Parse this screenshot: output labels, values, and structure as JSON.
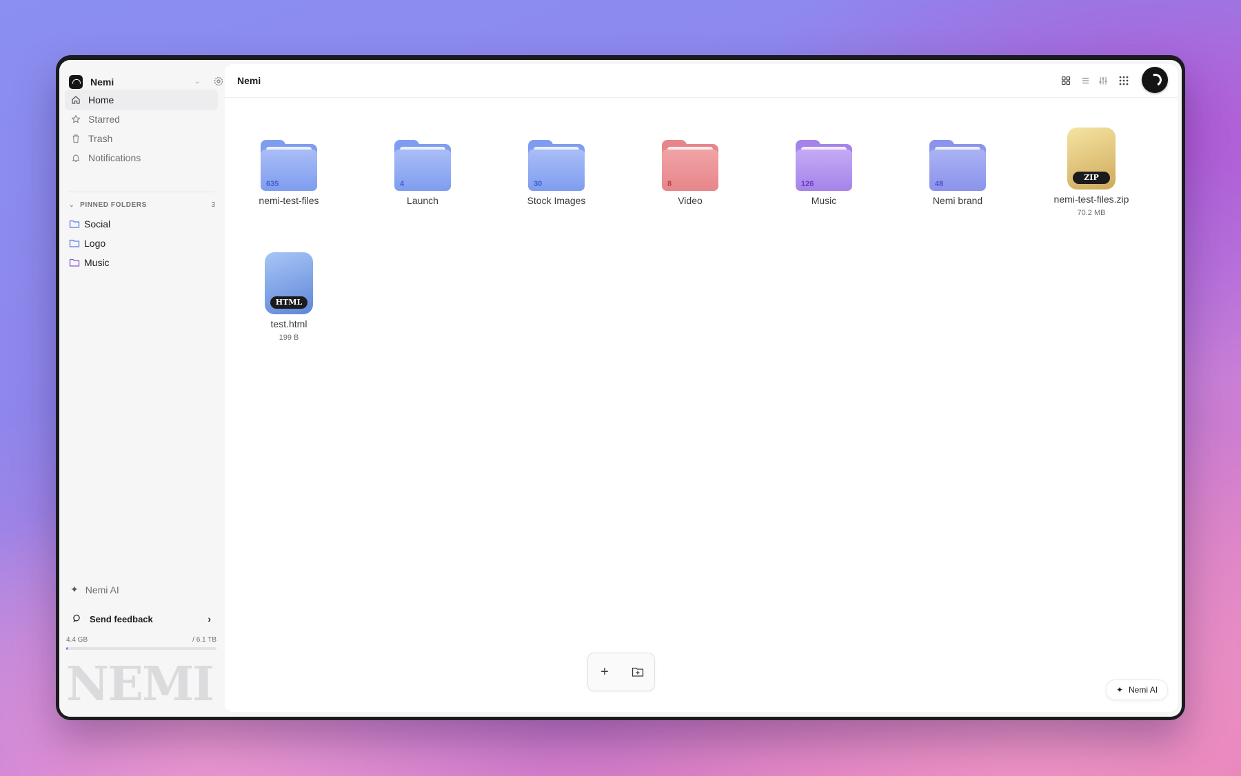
{
  "workspace": {
    "name": "Nemi"
  },
  "sidebar": {
    "nav": [
      {
        "label": "Home",
        "icon": "home-icon",
        "active": true
      },
      {
        "label": "Starred",
        "icon": "star-icon",
        "active": false
      },
      {
        "label": "Trash",
        "icon": "trash-icon",
        "active": false
      },
      {
        "label": "Notifications",
        "icon": "bell-icon",
        "active": false
      }
    ],
    "pinned": {
      "heading": "PINNED FOLDERS",
      "count": "3",
      "items": [
        {
          "label": "Social",
          "color": "#5b78e6"
        },
        {
          "label": "Logo",
          "color": "#5b78e6"
        },
        {
          "label": "Music",
          "color": "#8a56d9"
        }
      ]
    },
    "ai_label": "Nemi AI",
    "feedback_label": "Send feedback",
    "storage": {
      "used": "4.4 GB",
      "total": "/ 6.1 TB",
      "fraction": 0.01
    },
    "watermark": "NEMI"
  },
  "header": {
    "breadcrumb": "Nemi"
  },
  "items": [
    {
      "kind": "folder",
      "name": "nemi-test-files",
      "count": "635",
      "tab": "#7f9df0",
      "front": "#a9bdf6",
      "text": "#3f5fcf"
    },
    {
      "kind": "folder",
      "name": "Launch",
      "count": "4",
      "tab": "#7f9df0",
      "front": "#a9bdf6",
      "text": "#3f5fcf"
    },
    {
      "kind": "folder",
      "name": "Stock Images",
      "count": "30",
      "tab": "#7f9df0",
      "front": "#a9bdf6",
      "text": "#3f5fcf"
    },
    {
      "kind": "folder",
      "name": "Video",
      "count": "8",
      "tab": "#e7868a",
      "front": "#f0a3a6",
      "text": "#b3424a"
    },
    {
      "kind": "folder",
      "name": "Music",
      "count": "126",
      "tab": "#a583ea",
      "front": "#c5aaf4",
      "text": "#6a3bc7"
    },
    {
      "kind": "folder",
      "name": "Nemi brand",
      "count": "48",
      "tab": "#8b93ec",
      "front": "#aab2f4",
      "text": "#4a52c7"
    },
    {
      "kind": "file",
      "name": "nemi-test-files.zip",
      "size": "70.2 MB",
      "badge": "ZIP",
      "c1": "#f4e4a3",
      "c2": "#cfa95a"
    },
    {
      "kind": "file",
      "name": "test.html",
      "size": "199 B",
      "badge": "HTML",
      "c1": "#a7c6f6",
      "c2": "#5f86d8"
    }
  ],
  "ai_button": "Nemi AI",
  "accent": "#5b64e0"
}
